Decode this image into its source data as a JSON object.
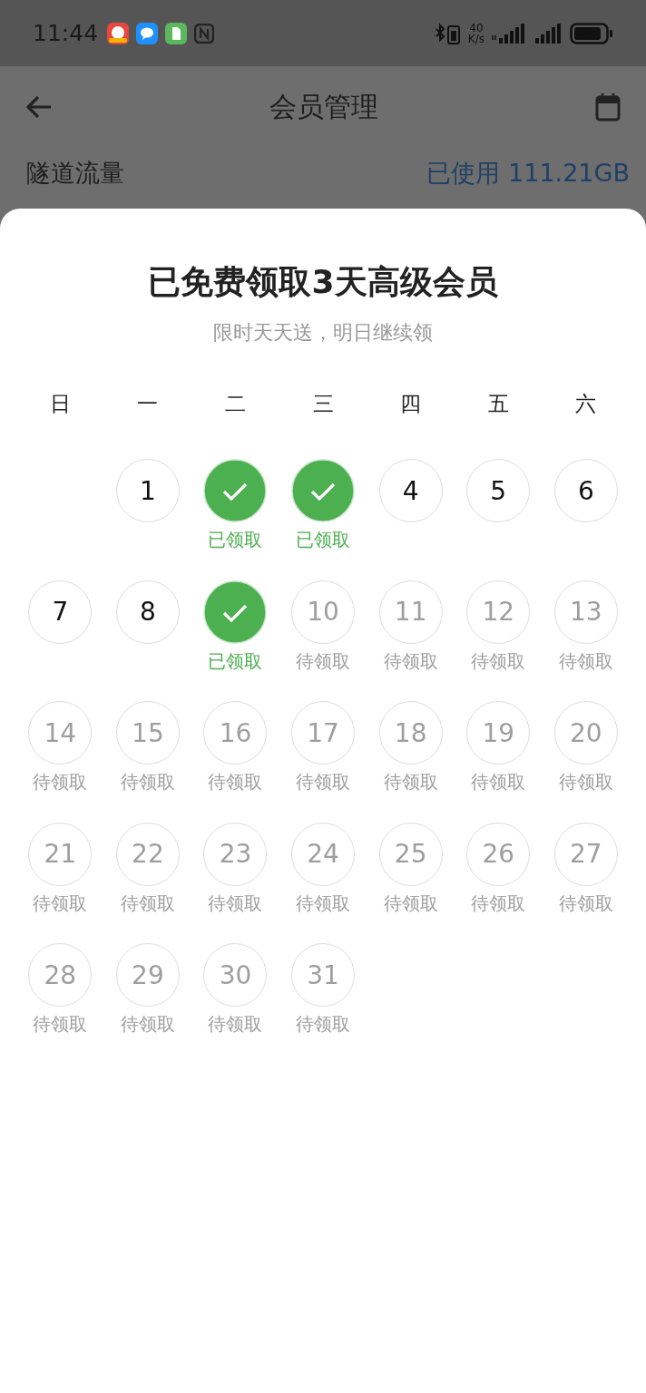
{
  "status_bar": {
    "time": "11:44",
    "net_speed_value": "40",
    "net_speed_unit": "K/s"
  },
  "app_bar": {
    "title": "会员管理"
  },
  "usage": {
    "label": "隧道流量",
    "value": "已使用 111.21GB"
  },
  "sheet": {
    "title": "已免费领取3天高级会员",
    "subtitle": "限时天天送，明日继续领",
    "weekdays": [
      "日",
      "一",
      "二",
      "三",
      "四",
      "五",
      "六"
    ],
    "days": [
      {
        "kind": "blank"
      },
      {
        "kind": "missed",
        "day": "1"
      },
      {
        "kind": "claimed",
        "label": "已领取"
      },
      {
        "kind": "claimed",
        "label": "已领取"
      },
      {
        "kind": "missed",
        "day": "4"
      },
      {
        "kind": "missed",
        "day": "5"
      },
      {
        "kind": "missed",
        "day": "6"
      },
      {
        "kind": "missed",
        "day": "7"
      },
      {
        "kind": "missed",
        "day": "8"
      },
      {
        "kind": "claimed",
        "label": "已领取"
      },
      {
        "kind": "pending",
        "day": "10",
        "label": "待领取"
      },
      {
        "kind": "pending",
        "day": "11",
        "label": "待领取"
      },
      {
        "kind": "pending",
        "day": "12",
        "label": "待领取"
      },
      {
        "kind": "pending",
        "day": "13",
        "label": "待领取"
      },
      {
        "kind": "pending",
        "day": "14",
        "label": "待领取"
      },
      {
        "kind": "pending",
        "day": "15",
        "label": "待领取"
      },
      {
        "kind": "pending",
        "day": "16",
        "label": "待领取"
      },
      {
        "kind": "pending",
        "day": "17",
        "label": "待领取"
      },
      {
        "kind": "pending",
        "day": "18",
        "label": "待领取"
      },
      {
        "kind": "pending",
        "day": "19",
        "label": "待领取"
      },
      {
        "kind": "pending",
        "day": "20",
        "label": "待领取"
      },
      {
        "kind": "pending",
        "day": "21",
        "label": "待领取"
      },
      {
        "kind": "pending",
        "day": "22",
        "label": "待领取"
      },
      {
        "kind": "pending",
        "day": "23",
        "label": "待领取"
      },
      {
        "kind": "pending",
        "day": "24",
        "label": "待领取"
      },
      {
        "kind": "pending",
        "day": "25",
        "label": "待领取"
      },
      {
        "kind": "pending",
        "day": "26",
        "label": "待领取"
      },
      {
        "kind": "pending",
        "day": "27",
        "label": "待领取"
      },
      {
        "kind": "pending",
        "day": "28",
        "label": "待领取"
      },
      {
        "kind": "pending",
        "day": "29",
        "label": "待领取"
      },
      {
        "kind": "pending",
        "day": "30",
        "label": "待领取"
      },
      {
        "kind": "pending",
        "day": "31",
        "label": "待领取"
      }
    ]
  }
}
